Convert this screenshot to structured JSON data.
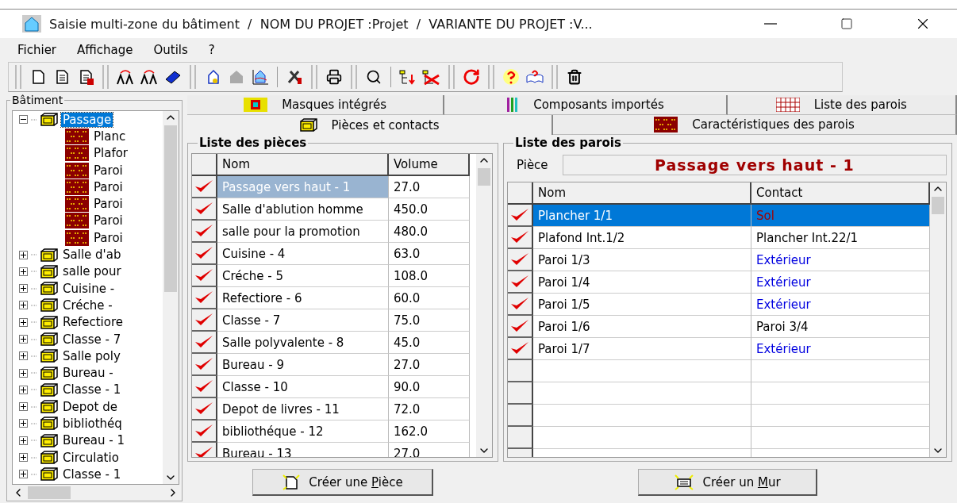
{
  "window": {
    "title": "Saisie multi-zone du bâtiment  /  NOM DU PROJET :Projet  /  VARIANTE DU PROJET :V..."
  },
  "menu": [
    "Fichier",
    "Affichage",
    "Outils",
    "?"
  ],
  "sidebar": {
    "title": "Bâtiment",
    "tree": [
      {
        "label": "Passage",
        "kind": "room",
        "expanded": true,
        "selected": true,
        "children": [
          {
            "label": "Planc",
            "kind": "wall",
            "selected": false
          },
          {
            "label": "Plafor",
            "kind": "wall",
            "selected": false
          },
          {
            "label": "Paroi",
            "kind": "wall",
            "selected": false
          },
          {
            "label": "Paroi",
            "kind": "wall",
            "selected": false
          },
          {
            "label": "Paroi",
            "kind": "wall",
            "selected": false
          },
          {
            "label": "Paroi",
            "kind": "wall",
            "selected": false
          },
          {
            "label": "Paroi",
            "kind": "wall",
            "selected": false
          }
        ]
      },
      {
        "label": "Salle d'ab",
        "kind": "room",
        "expanded": false,
        "selected": false
      },
      {
        "label": "salle pour",
        "kind": "room",
        "expanded": false,
        "selected": false
      },
      {
        "label": "Cuisine -",
        "kind": "room",
        "expanded": false,
        "selected": false
      },
      {
        "label": "Créche -",
        "kind": "room",
        "expanded": false,
        "selected": false
      },
      {
        "label": "Refectiore",
        "kind": "room",
        "expanded": false,
        "selected": false
      },
      {
        "label": "Classe - 7",
        "kind": "room",
        "expanded": false,
        "selected": false
      },
      {
        "label": "Salle poly",
        "kind": "room",
        "expanded": false,
        "selected": false
      },
      {
        "label": "Bureau -",
        "kind": "room",
        "expanded": false,
        "selected": false
      },
      {
        "label": "Classe - 1",
        "kind": "room",
        "expanded": false,
        "selected": false
      },
      {
        "label": "Depot de",
        "kind": "room",
        "expanded": false,
        "selected": false
      },
      {
        "label": "bibliothéq",
        "kind": "room",
        "expanded": false,
        "selected": false
      },
      {
        "label": "Bureau - 1",
        "kind": "room",
        "expanded": false,
        "selected": false
      },
      {
        "label": "Circulatio",
        "kind": "room",
        "expanded": false,
        "selected": false
      },
      {
        "label": "Classe - 1",
        "kind": "room",
        "expanded": false,
        "selected": false
      }
    ]
  },
  "tabs": [
    [
      {
        "label": "Masques intégrés",
        "kind": "mask",
        "selected": false
      },
      {
        "label": "Composants importés",
        "kind": "components",
        "selected": false
      },
      {
        "label": "Liste des parois",
        "kind": "grid",
        "selected": false
      }
    ],
    [
      {
        "label": "Pièces et contacts",
        "kind": "room",
        "selected": true
      },
      {
        "label": "Caractéristiques des parois",
        "kind": "wall",
        "selected": false
      }
    ]
  ],
  "rooms": {
    "title": "Liste des pièces",
    "columns": [
      "Nom",
      "Volume"
    ],
    "rows": [
      {
        "name": "Passage vers haut - 1",
        "volume": "27.0",
        "checked": true,
        "selected": true
      },
      {
        "name": "Salle d'ablution homme",
        "volume": "450.0",
        "checked": true,
        "selected": false
      },
      {
        "name": "salle pour la promotion",
        "volume": "480.0",
        "checked": true,
        "selected": false
      },
      {
        "name": "Cuisine - 4",
        "volume": "63.0",
        "checked": true,
        "selected": false
      },
      {
        "name": "Créche - 5",
        "volume": "108.0",
        "checked": true,
        "selected": false
      },
      {
        "name": "Refectiore - 6",
        "volume": "60.0",
        "checked": true,
        "selected": false
      },
      {
        "name": "Classe - 7",
        "volume": "75.0",
        "checked": true,
        "selected": false
      },
      {
        "name": "Salle polyvalente - 8",
        "volume": "45.0",
        "checked": true,
        "selected": false
      },
      {
        "name": "Bureau - 9",
        "volume": "27.0",
        "checked": true,
        "selected": false
      },
      {
        "name": "Classe - 10",
        "volume": "90.0",
        "checked": true,
        "selected": false
      },
      {
        "name": "Depot de livres - 11",
        "volume": "72.0",
        "checked": true,
        "selected": false
      },
      {
        "name": "bibliothéque - 12",
        "volume": "162.0",
        "checked": true,
        "selected": false
      },
      {
        "name": "Bureau - 13",
        "volume": "27.0",
        "checked": true,
        "selected": false
      }
    ],
    "button": {
      "before": "Créer une ",
      "accel": "P",
      "after": "ièce"
    }
  },
  "walls": {
    "title": "Liste des parois",
    "room_label": "Pièce",
    "room_value": "Passage vers haut - 1",
    "columns": [
      "Nom",
      "Contact"
    ],
    "rows": [
      {
        "name": "Plancher 1/1",
        "contact": "Sol",
        "kind": "ground",
        "checked": true,
        "selected": true
      },
      {
        "name": "Plafond Int.1/2",
        "contact": "Plancher Int.22/1",
        "kind": "internal",
        "checked": true,
        "selected": false
      },
      {
        "name": "Paroi 1/3",
        "contact": "Extérieur",
        "kind": "exterior",
        "checked": true,
        "selected": false
      },
      {
        "name": "Paroi 1/4",
        "contact": "Extérieur",
        "kind": "exterior",
        "checked": true,
        "selected": false
      },
      {
        "name": "Paroi 1/5",
        "contact": "Extérieur",
        "kind": "exterior",
        "checked": true,
        "selected": false
      },
      {
        "name": "Paroi 1/6",
        "contact": "Paroi 3/4",
        "kind": "internal",
        "checked": true,
        "selected": false
      },
      {
        "name": "Paroi 1/7",
        "contact": "Extérieur",
        "kind": "exterior",
        "checked": true,
        "selected": false
      }
    ],
    "button": {
      "before": "Créer un ",
      "accel": "M",
      "after": "ur"
    }
  }
}
